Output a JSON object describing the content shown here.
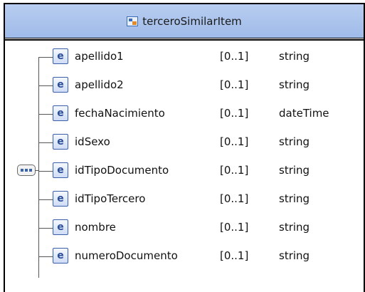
{
  "type_name": "terceroSimilarItem",
  "element_icon_letter": "e",
  "colors": {
    "header_bg": "#a8c2ed",
    "element_icon": "#2a4e9a"
  },
  "elements": [
    {
      "name": "apellido1",
      "cardinality": "[0..1]",
      "type": "string"
    },
    {
      "name": "apellido2",
      "cardinality": "[0..1]",
      "type": "string"
    },
    {
      "name": "fechaNacimiento",
      "cardinality": "[0..1]",
      "type": "dateTime"
    },
    {
      "name": "idSexo",
      "cardinality": "[0..1]",
      "type": "string"
    },
    {
      "name": "idTipoDocumento",
      "cardinality": "[0..1]",
      "type": "string"
    },
    {
      "name": "idTipoTercero",
      "cardinality": "[0..1]",
      "type": "string"
    },
    {
      "name": "nombre",
      "cardinality": "[0..1]",
      "type": "string"
    },
    {
      "name": "numeroDocumento",
      "cardinality": "[0..1]",
      "type": "string"
    }
  ]
}
